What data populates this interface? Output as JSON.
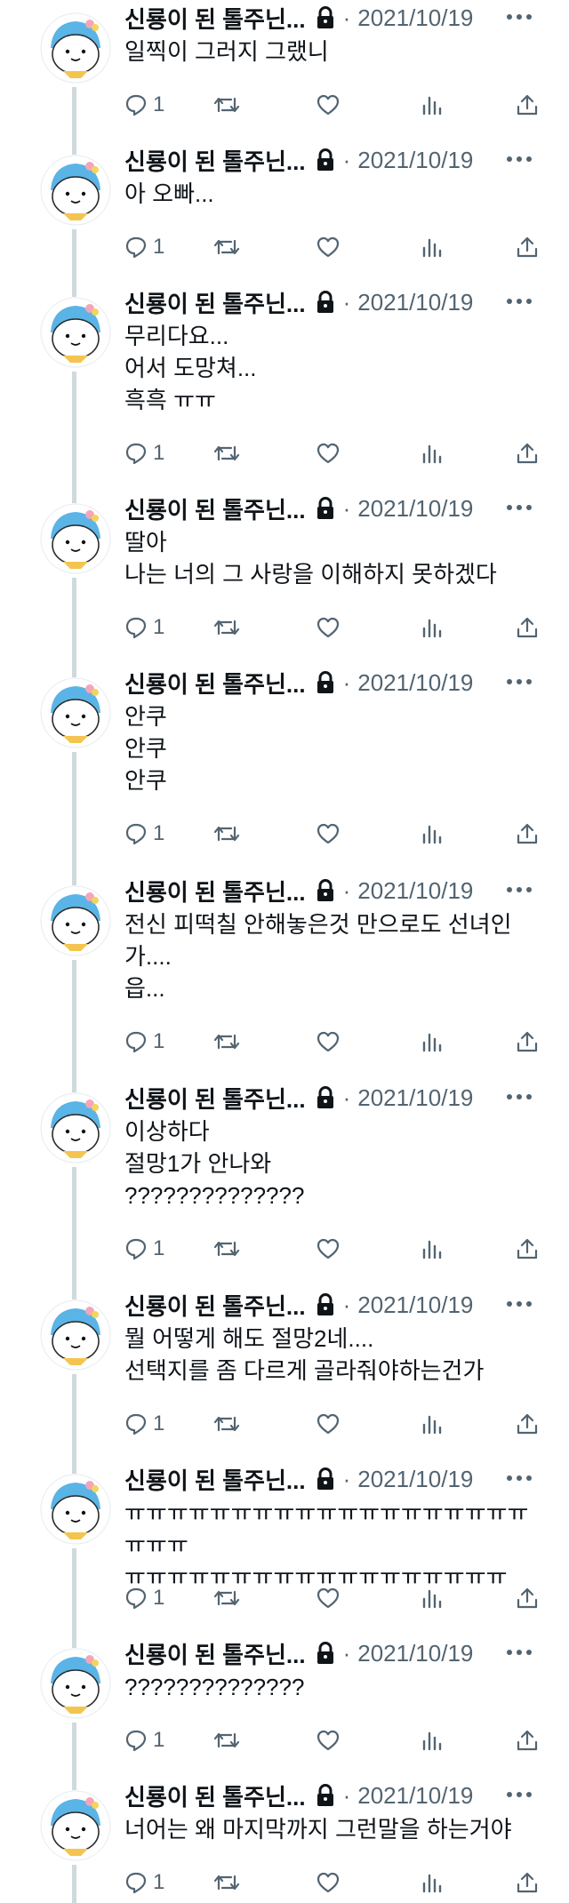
{
  "author": {
    "display_name": "신룡이 된 톨주닌...",
    "separator": "·"
  },
  "colors": {
    "text": "#0f1419",
    "secondary": "#536471",
    "thread_line": "#cfd9de",
    "avatar_blue": "#5ab4e6"
  },
  "icons": {
    "lock": "lock-icon",
    "more": "more-icon",
    "reply": "reply-icon",
    "retweet": "retweet-icon",
    "like": "heart-icon",
    "views": "views-icon",
    "share": "share-icon"
  },
  "tweets": [
    {
      "date": "2021/10/19",
      "text": "일찍이 그러지 그랬니",
      "reply_count": "1"
    },
    {
      "date": "2021/10/19",
      "text": "아 오빠...",
      "reply_count": "1"
    },
    {
      "date": "2021/10/19",
      "text": "무리다요...\n어서 도망쳐...\n흑흑 ㅠㅠ",
      "reply_count": "1"
    },
    {
      "date": "2021/10/19",
      "text": "딸아\n나는 너의 그 사랑을 이해하지 못하겠다",
      "reply_count": "1"
    },
    {
      "date": "2021/10/19",
      "text": "안쿠\n안쿠\n안쿠",
      "reply_count": "1"
    },
    {
      "date": "2021/10/19",
      "text": "전신 피떡칠 안해놓은것 만으로도 선녀인\n가....\n읍...",
      "reply_count": "1"
    },
    {
      "date": "2021/10/19",
      "text": "이상하다\n절망1가 안나와\n??????????????",
      "reply_count": "1"
    },
    {
      "date": "2021/10/19",
      "text": "뭘 어떻게 해도 절망2네....\n선택지를 좀 다르게 골라줘야하는건가",
      "reply_count": "1"
    },
    {
      "date": "2021/10/19",
      "text": "ㅠㅠㅠㅠㅠㅠㅠㅠㅠㅠㅠㅠㅠㅠㅠㅠㅠㅠㅠㅠㅠㅠ\nㅠㅠㅠㅠㅠㅠㅠㅠㅠㅠㅠㅠㅠㅠㅠㅠㅠㅠ",
      "reply_count": "1"
    },
    {
      "date": "2021/10/19",
      "text": "??????????????",
      "reply_count": "1"
    },
    {
      "date": "2021/10/19",
      "text": "너어는 왜 마지막까지 그런말을 하는거야",
      "reply_count": "1"
    }
  ]
}
